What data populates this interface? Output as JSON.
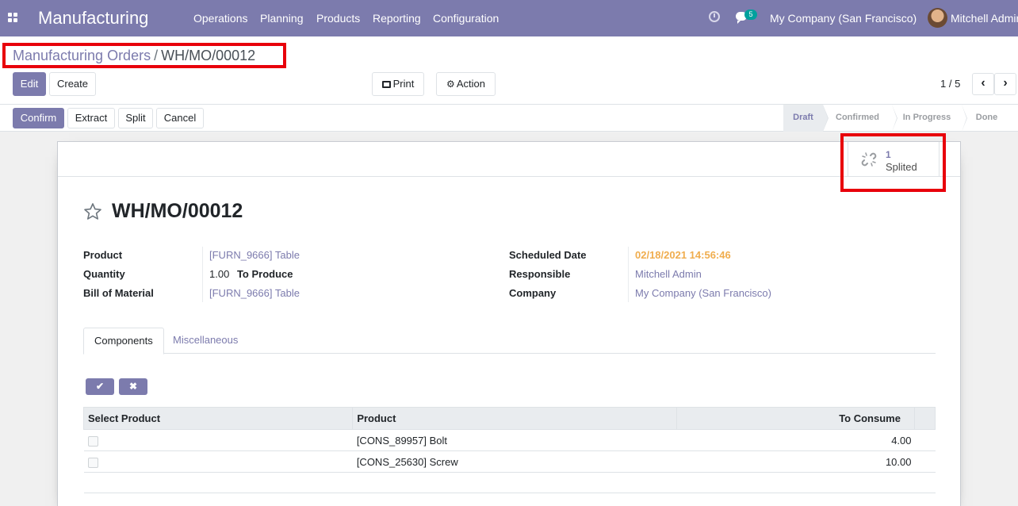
{
  "navbar": {
    "brand": "Manufacturing",
    "menu": [
      "Operations",
      "Planning",
      "Products",
      "Reporting",
      "Configuration"
    ],
    "chat_count": "5",
    "company": "My Company (San Francisco)",
    "user": "Mitchell Admin",
    "bg_color": "#7c7bad"
  },
  "breadcrumb": {
    "parent": "Manufacturing Orders",
    "separator": "/",
    "current": "WH/MO/00012"
  },
  "control": {
    "edit": "Edit",
    "create": "Create",
    "print": "Print",
    "action": "Action",
    "pager": "1 / 5"
  },
  "statusbar": {
    "buttons": [
      "Confirm",
      "Extract",
      "Split",
      "Cancel"
    ],
    "steps": [
      "Draft",
      "Confirmed",
      "In Progress",
      "Done"
    ],
    "active_step": "Draft"
  },
  "smart_button": {
    "value": "1",
    "label": "Splited"
  },
  "record": {
    "name": "WH/MO/00012",
    "product_label": "Product",
    "product": "[FURN_9666] Table",
    "quantity_label": "Quantity",
    "quantity": "1.00",
    "to_produce": "To Produce",
    "bom_label": "Bill of Material",
    "bom": "[FURN_9666] Table",
    "scheduled_label": "Scheduled Date",
    "scheduled": "02/18/2021 14:56:46",
    "responsible_label": "Responsible",
    "responsible": "Mitchell Admin",
    "company_label": "Company",
    "company": "My Company (San Francisco)"
  },
  "tabs": [
    "Components",
    "Miscellaneous"
  ],
  "table": {
    "headers": [
      "Select Product",
      "Product",
      "To Consume"
    ],
    "rows": [
      {
        "product": "[CONS_89957] Bolt",
        "qty": "4.00"
      },
      {
        "product": "[CONS_25630] Screw",
        "qty": "10.00"
      }
    ]
  },
  "icons": {
    "apps": "apps-grid-icon",
    "star": "star-outline-icon",
    "split": "unlink-icon",
    "print": "printer-icon",
    "action": "gear-icon",
    "confirm_mini": "check-icon",
    "cancel_mini": "x-icon"
  },
  "colors": {
    "primary": "#7c7bad",
    "highlight": "#e8000b",
    "warning_date": "#f0ad4e",
    "chat_badge": "#00a09d"
  }
}
